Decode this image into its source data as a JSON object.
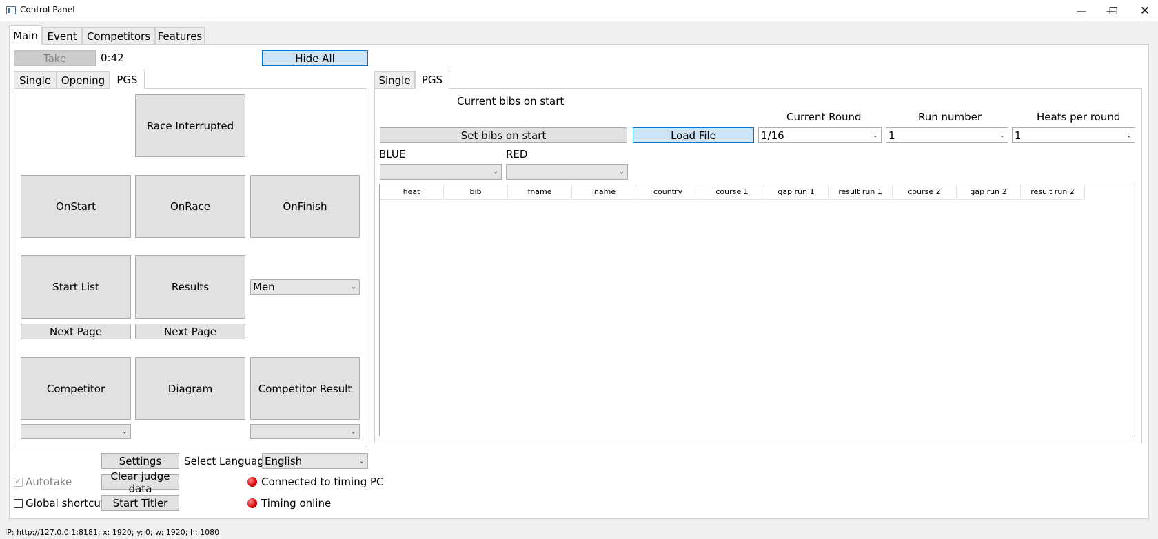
{
  "window": {
    "title": "Control Panel",
    "minimize": "—",
    "maximize": "☐",
    "close": "✕"
  },
  "main_tabs": [
    "Main",
    "Event",
    "Competitors",
    "Features"
  ],
  "top": {
    "take_label": "Take",
    "timer": "0:42",
    "hide_all_label": "Hide All"
  },
  "left_tabs": [
    "Single",
    "Opening",
    "PGS"
  ],
  "left_panel": {
    "race_interrupted": "Race Interrupted",
    "on_start": "OnStart",
    "on_race": "OnRace",
    "on_finish": "OnFinish",
    "start_list": "Start List",
    "results": "Results",
    "gender_select": "Men",
    "next_page_1": "Next Page",
    "next_page_2": "Next Page",
    "competitor": "Competitor",
    "diagram": "Diagram",
    "competitor_result": "Competitor Result",
    "competitor_select": "",
    "competitor_result_select": ""
  },
  "right_tabs": [
    "Single",
    "PGS"
  ],
  "right_panel": {
    "current_bibs_label": "Current bibs on start",
    "current_round_label": "Current Round",
    "run_number_label": "Run number",
    "heats_per_round_label": "Heats per round",
    "set_bibs_label": "Set bibs on start",
    "load_file_label": "Load File",
    "current_round_value": "1/16",
    "run_number_value": "1",
    "heats_per_round_value": "1",
    "blue_label": "BLUE",
    "red_label": "RED",
    "blue_select": "",
    "red_select": ""
  },
  "table": {
    "columns": [
      "heat",
      "bib",
      "fname",
      "lname",
      "country",
      "course 1",
      "gap run 1",
      "result run 1",
      "course 2",
      "gap run 2",
      "result run 2"
    ],
    "rows": []
  },
  "bottom": {
    "settings_label": "Settings",
    "select_language_label": "Select Language",
    "language_value": "English",
    "autotake_label": "Autotake",
    "autotake_checked": true,
    "clear_judge_label": "Clear judge data",
    "connected_label": "Connected to timing PC",
    "global_shortcut_label": "Global shortcut",
    "global_shortcut_checked": false,
    "start_titler_label": "Start Titler",
    "timing_online_label": "Timing online",
    "status_color": "#d00000"
  },
  "statusbar": {
    "text": "IP: http://127.0.0.1:8181; x: 1920; y: 0; w: 1920; h: 1080"
  }
}
